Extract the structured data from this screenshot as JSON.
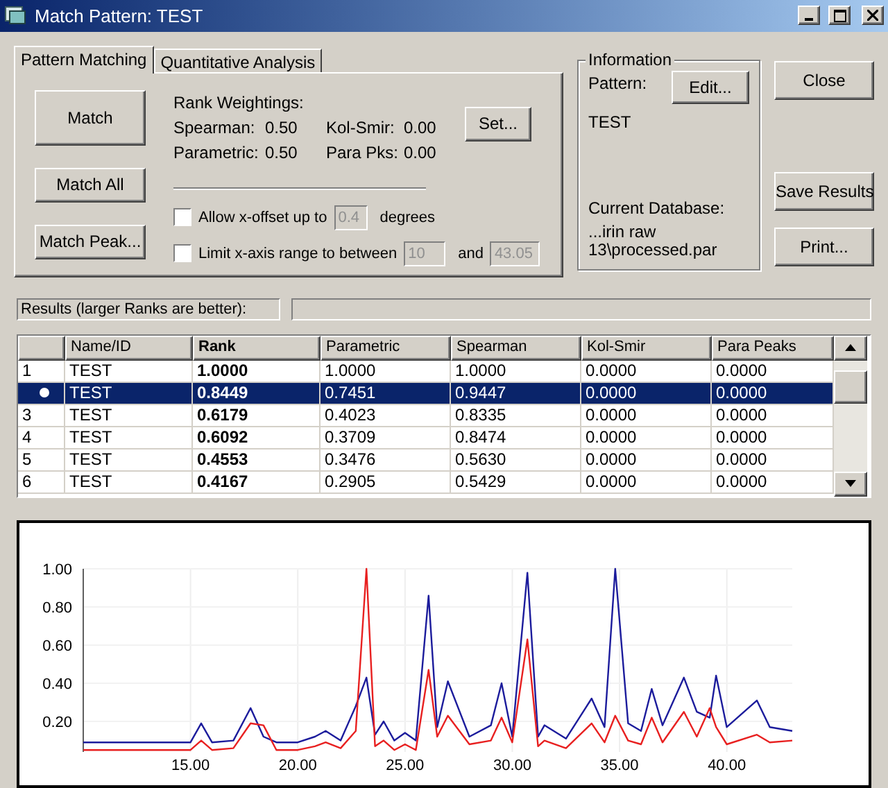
{
  "window": {
    "title": "Match Pattern: TEST"
  },
  "tabs": [
    {
      "label": "Pattern Matching",
      "selected": true
    },
    {
      "label": "Quantitative Analysis",
      "selected": false
    }
  ],
  "actions": [
    "Match",
    "Match All",
    "Match Peak..."
  ],
  "rank_weightings": {
    "title": "Rank Weightings:",
    "items": [
      {
        "label": "Spearman:",
        "value": "0.50"
      },
      {
        "label": "Kol-Smir:",
        "value": "0.00"
      },
      {
        "label": "Parametric:",
        "value": "0.50"
      },
      {
        "label": "Para Pks:",
        "value": "0.00"
      }
    ],
    "set_button": "Set..."
  },
  "options": [
    {
      "label": "Allow x-offset up to",
      "checked": false,
      "disabled": true,
      "value": "0.4",
      "suffix": "degrees"
    },
    {
      "label": "Limit x-axis range to between",
      "checked": false,
      "disabled": true,
      "value": "10",
      "joiner": "and",
      "value2": "43.05"
    }
  ],
  "information": {
    "title": "Information",
    "pattern_label": "Pattern:",
    "edit_button": "Edit...",
    "pattern": "TEST",
    "database_label": "Current Database:",
    "database": "...irin raw 13\\processed.par"
  },
  "side_buttons": [
    "Close",
    "Save Results",
    "Print..."
  ],
  "results_label": "Results (larger Ranks are better):",
  "table": {
    "columns": [
      "Name/ID",
      "Rank",
      "Parametric",
      "Spearman",
      "Kol-Smir",
      "Para Peaks"
    ],
    "rows": [
      {
        "row_header": "1",
        "selected": false,
        "cells": [
          "TEST",
          "1.0000",
          "1.0000",
          "1.0000",
          "0.0000",
          "0.0000"
        ]
      },
      {
        "selected": true,
        "cells": [
          "TEST",
          "0.8449",
          "0.7451",
          "0.9447",
          "0.0000",
          "0.0000"
        ]
      },
      {
        "row_header": "3",
        "selected": false,
        "cells": [
          "TEST",
          "0.6179",
          "0.4023",
          "0.8335",
          "0.0000",
          "0.0000"
        ]
      },
      {
        "row_header": "4",
        "selected": false,
        "cells": [
          "TEST",
          "0.6092",
          "0.3709",
          "0.8474",
          "0.0000",
          "0.0000"
        ]
      },
      {
        "row_header": "5",
        "selected": false,
        "cells": [
          "TEST",
          "0.4553",
          "0.3476",
          "0.5630",
          "0.0000",
          "0.0000"
        ]
      },
      {
        "row_header": "6",
        "selected": false,
        "cells": [
          "TEST",
          "0.4167",
          "0.2905",
          "0.5429",
          "0.0000",
          "0.0000"
        ]
      }
    ]
  },
  "chart": {
    "chart_data": {
      "type": "line",
      "x": [
        10,
        15,
        15.5,
        16,
        17,
        17.8,
        18.4,
        19,
        20,
        20.8,
        21.3,
        22,
        22.7,
        23.2,
        23.6,
        24,
        24.5,
        25,
        25.5,
        26.1,
        26.5,
        27,
        28,
        29,
        29.5,
        30,
        30.7,
        31.2,
        31.5,
        32.5,
        33.7,
        34.3,
        34.8,
        35.4,
        36,
        36.5,
        37,
        38,
        38.6,
        39.2,
        39.5,
        40,
        41.4,
        42,
        43.05
      ],
      "series": [
        {
          "color": "#1c1c9c",
          "values": [
            0.09,
            0.09,
            0.19,
            0.09,
            0.1,
            0.27,
            0.12,
            0.09,
            0.09,
            0.12,
            0.15,
            0.1,
            0.28,
            0.43,
            0.13,
            0.2,
            0.1,
            0.14,
            0.1,
            0.86,
            0.17,
            0.41,
            0.12,
            0.18,
            0.4,
            0.12,
            0.98,
            0.12,
            0.18,
            0.11,
            0.32,
            0.17,
            1.0,
            0.19,
            0.15,
            0.37,
            0.18,
            0.43,
            0.25,
            0.22,
            0.44,
            0.17,
            0.31,
            0.17,
            0.15
          ]
        },
        {
          "color": "#e82020",
          "values": [
            0.05,
            0.05,
            0.1,
            0.05,
            0.06,
            0.19,
            0.18,
            0.05,
            0.05,
            0.07,
            0.09,
            0.06,
            0.15,
            1.0,
            0.07,
            0.1,
            0.05,
            0.08,
            0.05,
            0.47,
            0.12,
            0.23,
            0.08,
            0.1,
            0.22,
            0.09,
            0.63,
            0.07,
            0.1,
            0.06,
            0.19,
            0.09,
            0.23,
            0.1,
            0.08,
            0.22,
            0.09,
            0.25,
            0.12,
            0.27,
            0.17,
            0.08,
            0.13,
            0.09,
            0.1
          ]
        }
      ],
      "grid": true,
      "xlim": [
        10,
        43.05
      ],
      "ylim": [
        0.04,
        1.0
      ],
      "xticks": [
        {
          "value": 15,
          "label": "15.00"
        },
        {
          "value": 20,
          "label": "20.00"
        },
        {
          "value": 25,
          "label": "25.00"
        },
        {
          "value": 30,
          "label": "30.00"
        },
        {
          "value": 35,
          "label": "35.00"
        },
        {
          "value": 40,
          "label": "40.00"
        }
      ],
      "yticks": [
        {
          "value": 0.2,
          "label": "0.20"
        },
        {
          "value": 0.4,
          "label": "0.40"
        },
        {
          "value": 0.6,
          "label": "0.60"
        },
        {
          "value": 0.8,
          "label": "0.80"
        },
        {
          "value": 1.0,
          "label": "1.00"
        }
      ]
    }
  }
}
